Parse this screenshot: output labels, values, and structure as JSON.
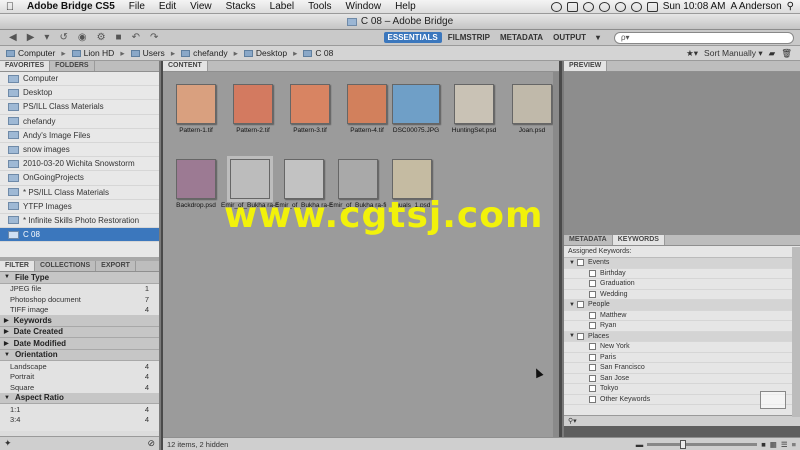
{
  "menubar": {
    "app": "Adobe Bridge CS5",
    "items": [
      "File",
      "Edit",
      "View",
      "Stacks",
      "Label",
      "Tools",
      "Window",
      "Help"
    ],
    "clock": "Sun 10:08 AM",
    "user": "A Anderson"
  },
  "window": {
    "title": "C 08 – Adobe Bridge"
  },
  "workspaces": [
    "ESSENTIALS",
    "FILMSTRIP",
    "METADATA",
    "OUTPUT"
  ],
  "search": {
    "placeholder": "ρ▾"
  },
  "path": {
    "crumbs": [
      "Computer",
      "Lion HD",
      "Users",
      "chefandy",
      "Desktop",
      "C 08"
    ],
    "sort": "Sort Manually ▾"
  },
  "left": {
    "tabs": [
      "FAVORITES",
      "FOLDERS"
    ],
    "favorites": [
      "Computer",
      "Desktop",
      "PS/ILL Class Materials",
      "chefandy",
      "Andy's Image Files",
      "snow images",
      "2010-03-20 Wichita Snowstorm",
      "OnGoingProjects",
      "* PS/ILL Class Materials",
      "YTFP Images",
      "* Infinite Skills Photo Restoration",
      "C 08"
    ],
    "selected_favorite": "C 08"
  },
  "filter": {
    "tabs": [
      "FILTER",
      "COLLECTIONS",
      "EXPORT"
    ],
    "sections": [
      {
        "title": "File Type",
        "open": true,
        "rows": [
          {
            "label": "JPEG file",
            "count": "1"
          },
          {
            "label": "Photoshop document",
            "count": "7"
          },
          {
            "label": "TIFF image",
            "count": "4"
          }
        ]
      },
      {
        "title": "Keywords",
        "open": false,
        "rows": []
      },
      {
        "title": "Date Created",
        "open": false,
        "rows": []
      },
      {
        "title": "Date Modified",
        "open": false,
        "rows": []
      },
      {
        "title": "Orientation",
        "open": true,
        "rows": [
          {
            "label": "Landscape",
            "count": "4"
          },
          {
            "label": "Portrait",
            "count": "4"
          },
          {
            "label": "Square",
            "count": "4"
          }
        ]
      },
      {
        "title": "Aspect Ratio",
        "open": true,
        "rows": [
          {
            "label": "1:1",
            "count": "4"
          },
          {
            "label": "3:4",
            "count": "4"
          }
        ]
      }
    ]
  },
  "content": {
    "tab": "CONTENT",
    "thumbs": [
      {
        "label": "Pattern-1.tif",
        "color": "#d9a07f"
      },
      {
        "label": "Pattern-2.tif",
        "color": "#d37a60"
      },
      {
        "label": "Pattern-3.tif",
        "color": "#d88462"
      },
      {
        "label": "Pattern-4.tif",
        "color": "#d2805c"
      },
      {
        "label": "DSC00075.JPG",
        "color": "#6f9fc7"
      },
      {
        "label": "HuntingSet.psd",
        "color": "#c9c2b5"
      },
      {
        "label": "Joan.psd",
        "color": "#c0b9aa"
      },
      {
        "label": "Backdrop.psd",
        "color": "#9c7a93"
      },
      {
        "label": "Emir_of_Bukha ra-crop.psd",
        "color": "#bcbcbc"
      },
      {
        "label": "Emir_of_Bukha ra-crop2.psd",
        "color": "#c2c2c2"
      },
      {
        "label": "Emir_of_Bukha ra-final.psd",
        "color": "#a9a9a9"
      },
      {
        "label": "Iguals_1.psd",
        "color": "#c5bba2"
      }
    ],
    "watermark": "www.cgtsj.com"
  },
  "right": {
    "preview_tab": "PREVIEW",
    "tabs": [
      "METADATA",
      "KEYWORDS"
    ],
    "kw_header": "Assigned Keywords:",
    "keywords": [
      {
        "label": "Events",
        "group": true,
        "count": "3"
      },
      {
        "label": "Birthday",
        "group": false,
        "count": ""
      },
      {
        "label": "Graduation",
        "group": false,
        "count": ""
      },
      {
        "label": "Wedding",
        "group": false,
        "count": ""
      },
      {
        "label": "People",
        "group": true,
        "count": "2"
      },
      {
        "label": "Matthew",
        "group": false,
        "count": ""
      },
      {
        "label": "Ryan",
        "group": false,
        "count": ""
      },
      {
        "label": "Places",
        "group": true,
        "count": "5"
      },
      {
        "label": "New York",
        "group": false,
        "count": ""
      },
      {
        "label": "Paris",
        "group": false,
        "count": ""
      },
      {
        "label": "San Francisco",
        "group": false,
        "count": ""
      },
      {
        "label": "San Jose",
        "group": false,
        "count": ""
      },
      {
        "label": "Tokyo",
        "group": false,
        "count": ""
      },
      {
        "label": "Other Keywords",
        "group": false,
        "count": ""
      }
    ]
  },
  "status": {
    "text": "12 items, 2 hidden"
  }
}
